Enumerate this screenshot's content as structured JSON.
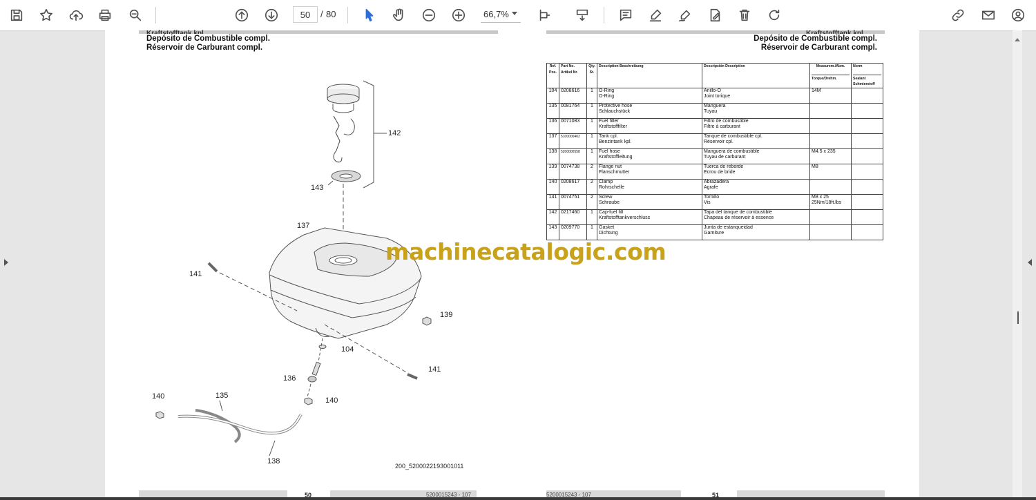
{
  "toolbar": {
    "current_page": "50",
    "page_separator": "/",
    "total_pages": "80",
    "zoom": "66,7%",
    "icons": [
      "save-icon",
      "bookmark-star-icon",
      "upload-icon",
      "print-icon",
      "zoom-search-icon",
      "page-up-icon",
      "page-down-icon",
      "select-cursor-icon",
      "hand-icon",
      "zoom-out-icon",
      "zoom-in-icon",
      "fit-page-icon",
      "scroll-mode-icon",
      "comment-icon",
      "highlight-icon",
      "sign-icon",
      "edit-pdf-icon",
      "delete-icon",
      "rotate-icon",
      "share-link-icon",
      "email-icon",
      "account-icon"
    ]
  },
  "left_page": {
    "header_cut": "Kraftstofftank kpl.",
    "title_es": "Depósito de Combustible compl.",
    "title_fr": "Réservoir de Carburant compl.",
    "callouts": [
      "142",
      "143",
      "137",
      "141",
      "139",
      "104",
      "141",
      "136",
      "140",
      "135",
      "140",
      "138"
    ],
    "figure_code": "200_5200022193001011",
    "footer_page": "50",
    "footer_code": "5200015243 - 107"
  },
  "right_page": {
    "header_cut": "Kraftstofftank kpl.",
    "title_es": "Depósito de Combustible compl.",
    "title_fr": "Réservoir de Carburant compl.",
    "footer_page": "51",
    "footer_code": "5200015243 - 107",
    "table": {
      "headers": {
        "ref": "Ref. Pos.",
        "art": "Part No. Artikel Nr.",
        "qty": "Qty. St.",
        "desc_de": "Description Beschreibung",
        "desc_es": "Descripción Description",
        "meas": "Measurem./Abm.",
        "torque": "Torque/Drehm.",
        "norm": "Norm",
        "sealant": "Sealant Schmierstoff"
      },
      "rows": [
        {
          "ref": "104",
          "art": "0208616",
          "qty": "1",
          "de1": "O-Ring",
          "de2": "O-Ring",
          "es1": "Anillo-O",
          "es2": "Joint torique",
          "meas": "14M",
          "meas2": "",
          "norm": ""
        },
        {
          "ref": "135",
          "art": "0081764",
          "qty": "1",
          "de1": "Protective hose",
          "de2": "Schlauchstück",
          "es1": "Manguera",
          "es2": "Tuyau",
          "meas": "",
          "meas2": "",
          "norm": ""
        },
        {
          "ref": "136",
          "art": "0071083",
          "qty": "1",
          "de1": "Fuel filter",
          "de2": "Kraftstofffilter",
          "es1": "Filtro de combustible",
          "es2": "Filtre à carburant",
          "meas": "",
          "meas2": "",
          "norm": ""
        },
        {
          "ref": "137",
          "art": "5100000402",
          "qty": "1",
          "de1": "Tank cpl.",
          "de2": "Benzintank kpl.",
          "es1": "Tanque de combustible cpl.",
          "es2": "Réservoir cpl.",
          "meas": "",
          "meas2": "",
          "norm": ""
        },
        {
          "ref": "138",
          "art": "5200000558",
          "qty": "1",
          "de1": "Fuel hose",
          "de2": "Kraftstoffleitung",
          "es1": "Manguera de combustible",
          "es2": "Tuyau de carburant",
          "meas": "M4.5 x 235",
          "meas2": "",
          "norm": ""
        },
        {
          "ref": "139",
          "art": "0074738",
          "qty": "2",
          "de1": "Flange nut",
          "de2": "Flanschmutter",
          "es1": "Tuerca de reborde",
          "es2": "Ecrou de bride",
          "meas": "M8",
          "meas2": "",
          "norm": ""
        },
        {
          "ref": "140",
          "art": "0208617",
          "qty": "2",
          "de1": "Clamp",
          "de2": "Rohrschelle",
          "es1": "Abrazadera",
          "es2": "Agrafe",
          "meas": "",
          "meas2": "",
          "norm": ""
        },
        {
          "ref": "141",
          "art": "0074751",
          "qty": "2",
          "de1": "Screw",
          "de2": "Schraube",
          "es1": "Tornillo",
          "es2": "Vis",
          "meas": "M8 x 25",
          "meas2": "25Nm/18ft.lbs",
          "norm": ""
        },
        {
          "ref": "142",
          "art": "0217460",
          "qty": "1",
          "de1": "Cap-fuel fill",
          "de2": "Kraftstofftankverschluss",
          "es1": "Tapa del tanque de combustible",
          "es2": "Chapeau de réservoir à essence",
          "meas": "",
          "meas2": "",
          "norm": ""
        },
        {
          "ref": "143",
          "art": "0209770",
          "qty": "1",
          "de1": "Gasket",
          "de2": "Dichtung",
          "es1": "Junta de estanqueidad",
          "es2": "Garniture",
          "meas": "",
          "meas2": "",
          "norm": ""
        }
      ]
    }
  },
  "watermark": "machinecatalogic.com"
}
